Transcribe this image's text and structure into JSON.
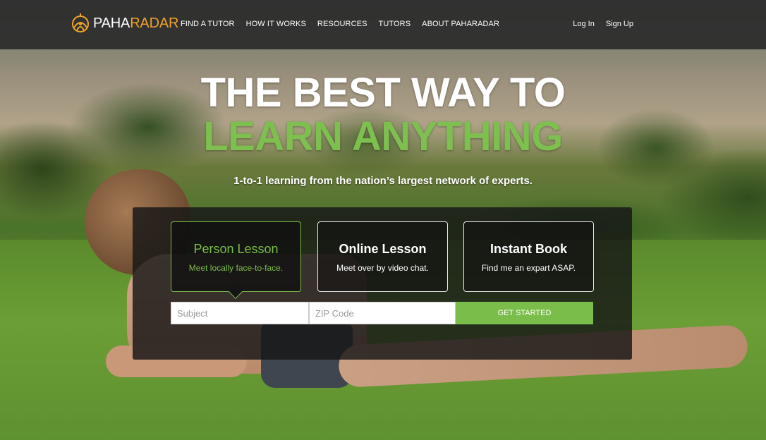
{
  "brand": {
    "name_part1": "PAHA",
    "name_part2": "RADAR",
    "accent": "#f0a32a"
  },
  "nav": {
    "items": [
      {
        "label": "FIND A TUTOR"
      },
      {
        "label": "HOW IT WORKS"
      },
      {
        "label": "RESOURCES"
      },
      {
        "label": "TUTORS"
      },
      {
        "label": "ABOUT PAHARADAR"
      }
    ],
    "login": "Log In",
    "signup": "Sign Up"
  },
  "hero": {
    "line1": "THE BEST WAY TO",
    "line2": "LEARN ANYTHING",
    "subtitle": "1-to-1 learning from the nation’s largest network of experts.",
    "accent": "#7ec04f"
  },
  "lesson_types": [
    {
      "title": "Person Lesson",
      "desc": "Meet locally face-to-face.",
      "active": true
    },
    {
      "title": "Online Lesson",
      "desc": "Meet over by video chat.",
      "active": false
    },
    {
      "title": "Instant Book",
      "desc": "Find me an expart ASAP.",
      "active": false
    }
  ],
  "search": {
    "subject_placeholder": "Subject",
    "zip_placeholder": "ZIP Code",
    "cta": "GET STARTED",
    "cta_color": "#7bbd4b"
  },
  "icons": {
    "logo": "radar-globe-icon"
  }
}
